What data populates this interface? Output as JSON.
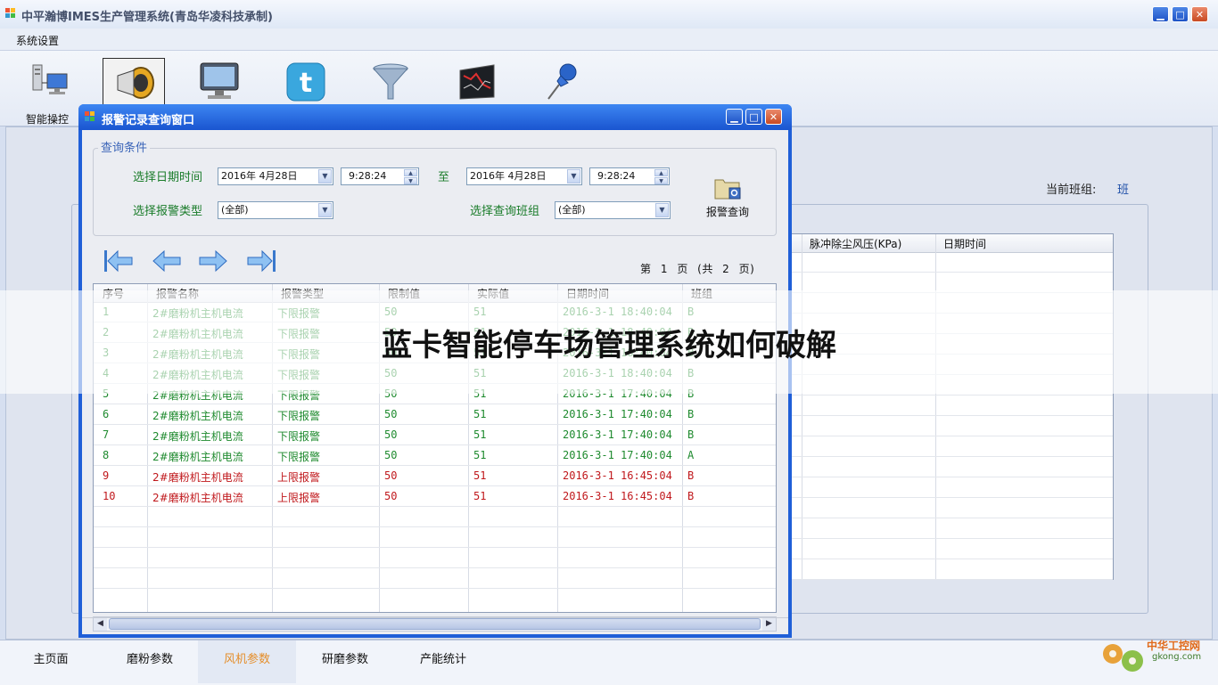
{
  "window": {
    "title": "中平瀚博IMES生产管理系统(青岛华凌科技承制)",
    "menu": [
      "系统设置"
    ],
    "toolbar": [
      {
        "icon": "computer-network-icon",
        "label": "智能操控"
      },
      {
        "icon": "loudspeaker-icon",
        "label": ""
      },
      {
        "icon": "monitor-icon",
        "label": ""
      },
      {
        "icon": "twitter-bird-icon",
        "label": ""
      },
      {
        "icon": "funnel-icon",
        "label": ""
      },
      {
        "icon": "line-chart-icon",
        "label": ""
      },
      {
        "icon": "pushpin-icon",
        "label": ""
      }
    ],
    "shift": {
      "label": "当前班组:",
      "value": "班"
    },
    "background_grid": {
      "columns": [
        "脉冲除尘风压(KPa)",
        "日期时间"
      ]
    },
    "bottom_tabs": [
      "主页面",
      "磨粉参数",
      "风机参数",
      "研磨参数",
      "产能统计"
    ],
    "active_tab": 2
  },
  "dialog": {
    "title": "报警记录查询窗口",
    "query_group": "查询条件",
    "date_label": "选择日期时间",
    "start_date": "2016年 4月28日",
    "start_time": "9:28:24",
    "to_label": "至",
    "end_date": "2016年 4月28日",
    "end_time": "9:28:24",
    "alarm_type_label": "选择报警类型",
    "alarm_type_value": "(全部)",
    "shift_label": "选择查询班组",
    "shift_value": "(全部)",
    "query_button": "报警查询",
    "paging": {
      "prefix": "第",
      "page": "1",
      "suffix": "页",
      "total_prefix": "(共",
      "total": "2",
      "total_suffix": "页)"
    },
    "columns": [
      "序号",
      "报警名称",
      "报警类型",
      "限制值",
      "实际值",
      "日期时间",
      "班组"
    ],
    "rows": [
      [
        "1",
        "2#磨粉机主机电流",
        "下限报警",
        "50",
        "51",
        "2016-3-1 18:40:04",
        "B"
      ],
      [
        "2",
        "2#磨粉机主机电流",
        "下限报警",
        "50",
        "51",
        "2016-3-1 18:40:04",
        "B"
      ],
      [
        "3",
        "2#磨粉机主机电流",
        "下限报警",
        "50",
        "51",
        "2016-3-1 18:40:04",
        "B"
      ],
      [
        "4",
        "2#磨粉机主机电流",
        "下限报警",
        "50",
        "51",
        "2016-3-1 18:40:04",
        "B"
      ],
      [
        "5",
        "2#磨粉机主机电流",
        "下限报警",
        "50",
        "51",
        "2016-3-1 17:40:04",
        "B"
      ],
      [
        "6",
        "2#磨粉机主机电流",
        "下限报警",
        "50",
        "51",
        "2016-3-1 17:40:04",
        "B"
      ],
      [
        "7",
        "2#磨粉机主机电流",
        "下限报警",
        "50",
        "51",
        "2016-3-1 17:40:04",
        "B"
      ],
      [
        "8",
        "2#磨粉机主机电流",
        "下限报警",
        "50",
        "51",
        "2016-3-1 17:40:04",
        "A"
      ],
      [
        "9",
        "2#磨粉机主机电流",
        "上限报警",
        "50",
        "51",
        "2016-3-1 16:45:04",
        "B"
      ],
      [
        "10",
        "2#磨粉机主机电流",
        "上限报警",
        "50",
        "51",
        "2016-3-1 16:45:04",
        "B"
      ]
    ],
    "row_colors": {
      "low": "#1e8a2e",
      "high": "#c0181c"
    }
  },
  "overlay": {
    "text": "蓝卡智能停车场管理系统如何破解"
  },
  "watermark": {
    "line1": "中华工控网",
    "line2": "gkong.com"
  }
}
